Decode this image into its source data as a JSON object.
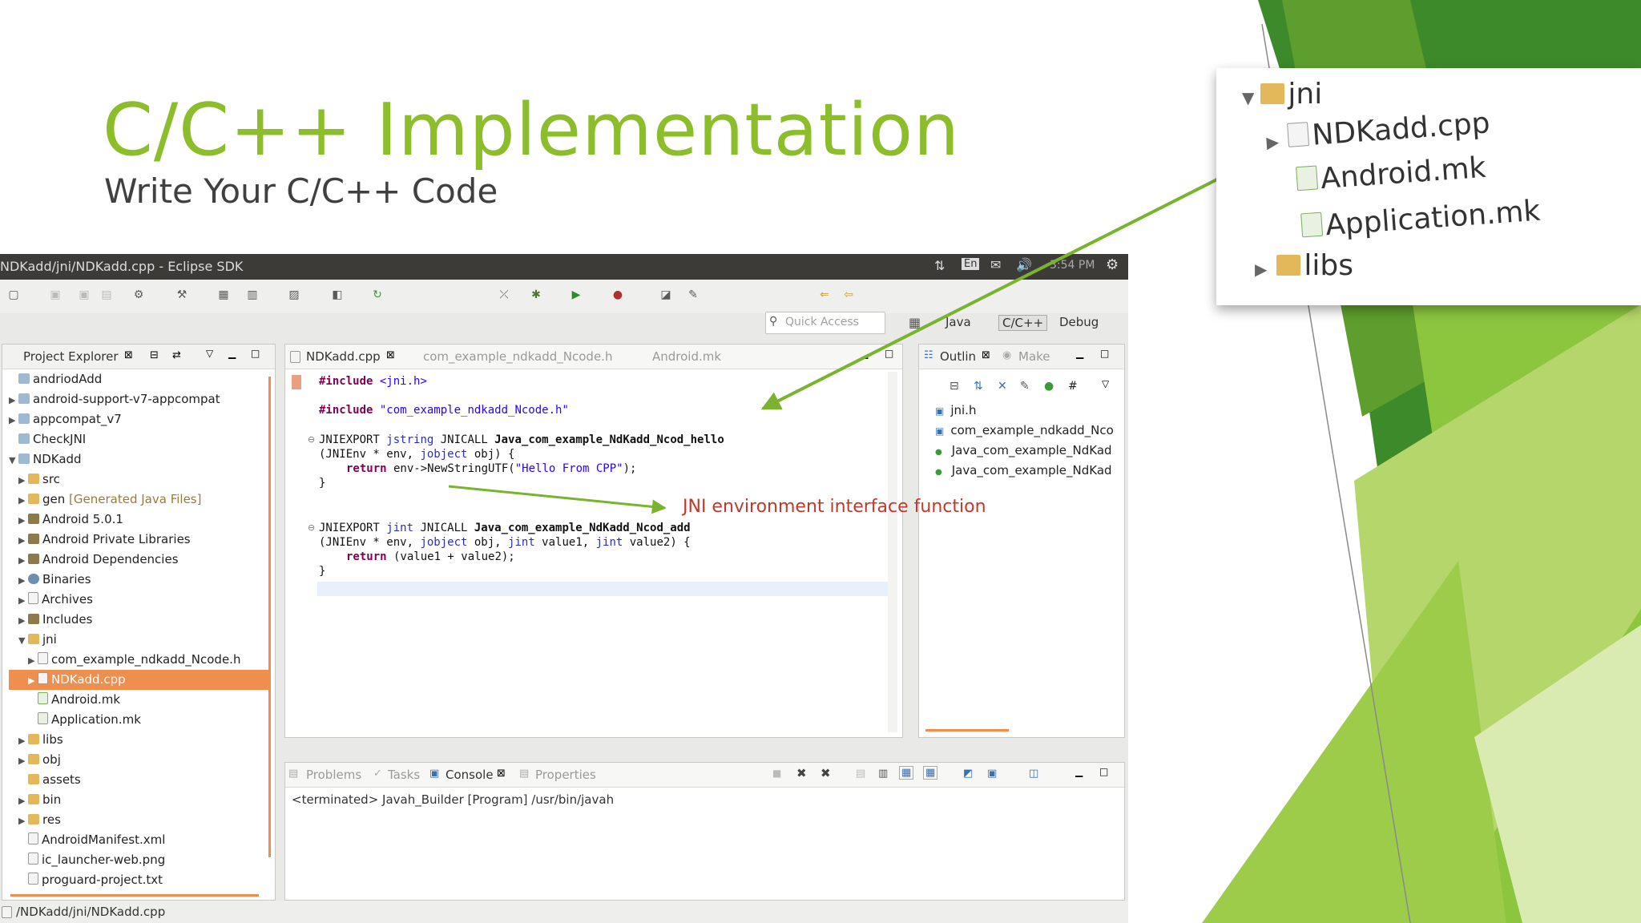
{
  "slide": {
    "title": "C/C++ Implementation",
    "subtitle": "Write Your C/C++ Code",
    "annotation": "JNI environment interface function"
  },
  "window": {
    "title": "NDKadd/jni/NDKadd.cpp - Eclipse SDK",
    "tray": {
      "lang": "En",
      "clock": "3:54 PM"
    }
  },
  "toolbar": {
    "quick_access_placeholder": "Quick Access",
    "perspectives": [
      "Java",
      "C/C++",
      "Debug"
    ]
  },
  "project_explorer": {
    "tab_label": "Project Explorer",
    "items": [
      {
        "label": "andriodAdd",
        "icon": "project-icon"
      },
      {
        "label": "android-support-v7-appcompat",
        "icon": "project-icon"
      },
      {
        "label": "appcompat_v7",
        "icon": "project-icon"
      },
      {
        "label": "CheckJNI",
        "icon": "project-icon"
      },
      {
        "label": "NDKadd",
        "icon": "project-icon"
      },
      {
        "label": "src",
        "icon": "folder-icon"
      },
      {
        "label": "gen",
        "extra": "[Generated Java Files]",
        "icon": "folder-icon"
      },
      {
        "label": "Android 5.0.1",
        "icon": "library-icon"
      },
      {
        "label": "Android Private Libraries",
        "icon": "library-icon"
      },
      {
        "label": "Android Dependencies",
        "icon": "library-icon"
      },
      {
        "label": "Binaries",
        "icon": "binaries-icon"
      },
      {
        "label": "Archives",
        "icon": "archives-icon"
      },
      {
        "label": "Includes",
        "icon": "includes-icon"
      },
      {
        "label": "jni",
        "icon": "folder-icon"
      },
      {
        "label": "com_example_ndkadd_Ncode.h",
        "icon": "header-file-icon"
      },
      {
        "label": "NDKadd.cpp",
        "icon": "cpp-file-icon"
      },
      {
        "label": "Android.mk",
        "icon": "makefile-icon"
      },
      {
        "label": "Application.mk",
        "icon": "makefile-icon"
      },
      {
        "label": "libs",
        "icon": "folder-icon"
      },
      {
        "label": "obj",
        "icon": "folder-icon"
      },
      {
        "label": "assets",
        "icon": "folder-icon"
      },
      {
        "label": "bin",
        "icon": "folder-icon"
      },
      {
        "label": "res",
        "icon": "folder-icon"
      },
      {
        "label": "AndroidManifest.xml",
        "icon": "xml-file-icon"
      },
      {
        "label": "ic_launcher-web.png",
        "icon": "image-file-icon"
      },
      {
        "label": "proguard-project.txt",
        "icon": "text-file-icon"
      }
    ]
  },
  "editor": {
    "tabs": [
      "NDKadd.cpp",
      "com_example_ndkadd_Ncode.h",
      "Android.mk"
    ],
    "lines": {
      "inc1_kw": "#include",
      "inc1_val": " <jni.h>",
      "inc2_kw": "#include",
      "inc2_val": " \"com_example_ndkadd_Ncode.h\"",
      "f1_a": "JNIEXPORT ",
      "f1_b": "jstring",
      "f1_c": " JNICALL ",
      "f1_d": "Java_com_example_NdKadd_Ncod_hello",
      "f1_p_a": "(JNIEnv * env, ",
      "f1_p_b": "jobject",
      "f1_p_c": " obj) {",
      "f1_r_a": "return",
      "f1_r_b": " env->NewStringUTF(",
      "f1_r_c": "\"Hello From CPP\"",
      "f1_r_d": ");",
      "close1": "}",
      "f2_a": "JNIEXPORT ",
      "f2_b": "jint",
      "f2_c": " JNICALL ",
      "f2_d": "Java_com_example_NdKadd_Ncod_add",
      "f2_p_a": "(JNIEnv * env, ",
      "f2_p_b": "jobject",
      "f2_p_c": " obj, ",
      "f2_p_d": "jint",
      "f2_p_e": " value1, ",
      "f2_p_f": "jint",
      "f2_p_g": " value2) {",
      "f2_r_a": "return",
      "f2_r_b": " (value1 + value2);",
      "close2": "}"
    }
  },
  "outline": {
    "tabs": [
      "Outlin",
      "Make"
    ],
    "items": [
      "jni.h",
      "com_example_ndkadd_Nco",
      "Java_com_example_NdKad",
      "Java_com_example_NdKad"
    ]
  },
  "bottom_panel": {
    "tabs": [
      "Problems",
      "Tasks",
      "Console",
      "Properties"
    ],
    "console_text": "<terminated> Javah_Builder [Program] /usr/bin/javah"
  },
  "status_bar": {
    "path": "/NDKadd/jni/NDKadd.cpp"
  },
  "zoom_panel": {
    "items": [
      {
        "label": "jni",
        "icon": "folder-icon"
      },
      {
        "label": "NDKadd.cpp",
        "icon": "cpp-file-icon"
      },
      {
        "label": "Android.mk",
        "icon": "makefile-icon"
      },
      {
        "label": "Application.mk",
        "icon": "makefile-icon"
      },
      {
        "label": "libs",
        "icon": "folder-icon"
      }
    ]
  },
  "colors": {
    "title_green": "#8cbd2a",
    "annotation_red": "#c0392b",
    "arrow_green": "#7ab32e",
    "selection_orange": "#ef8f4f"
  }
}
